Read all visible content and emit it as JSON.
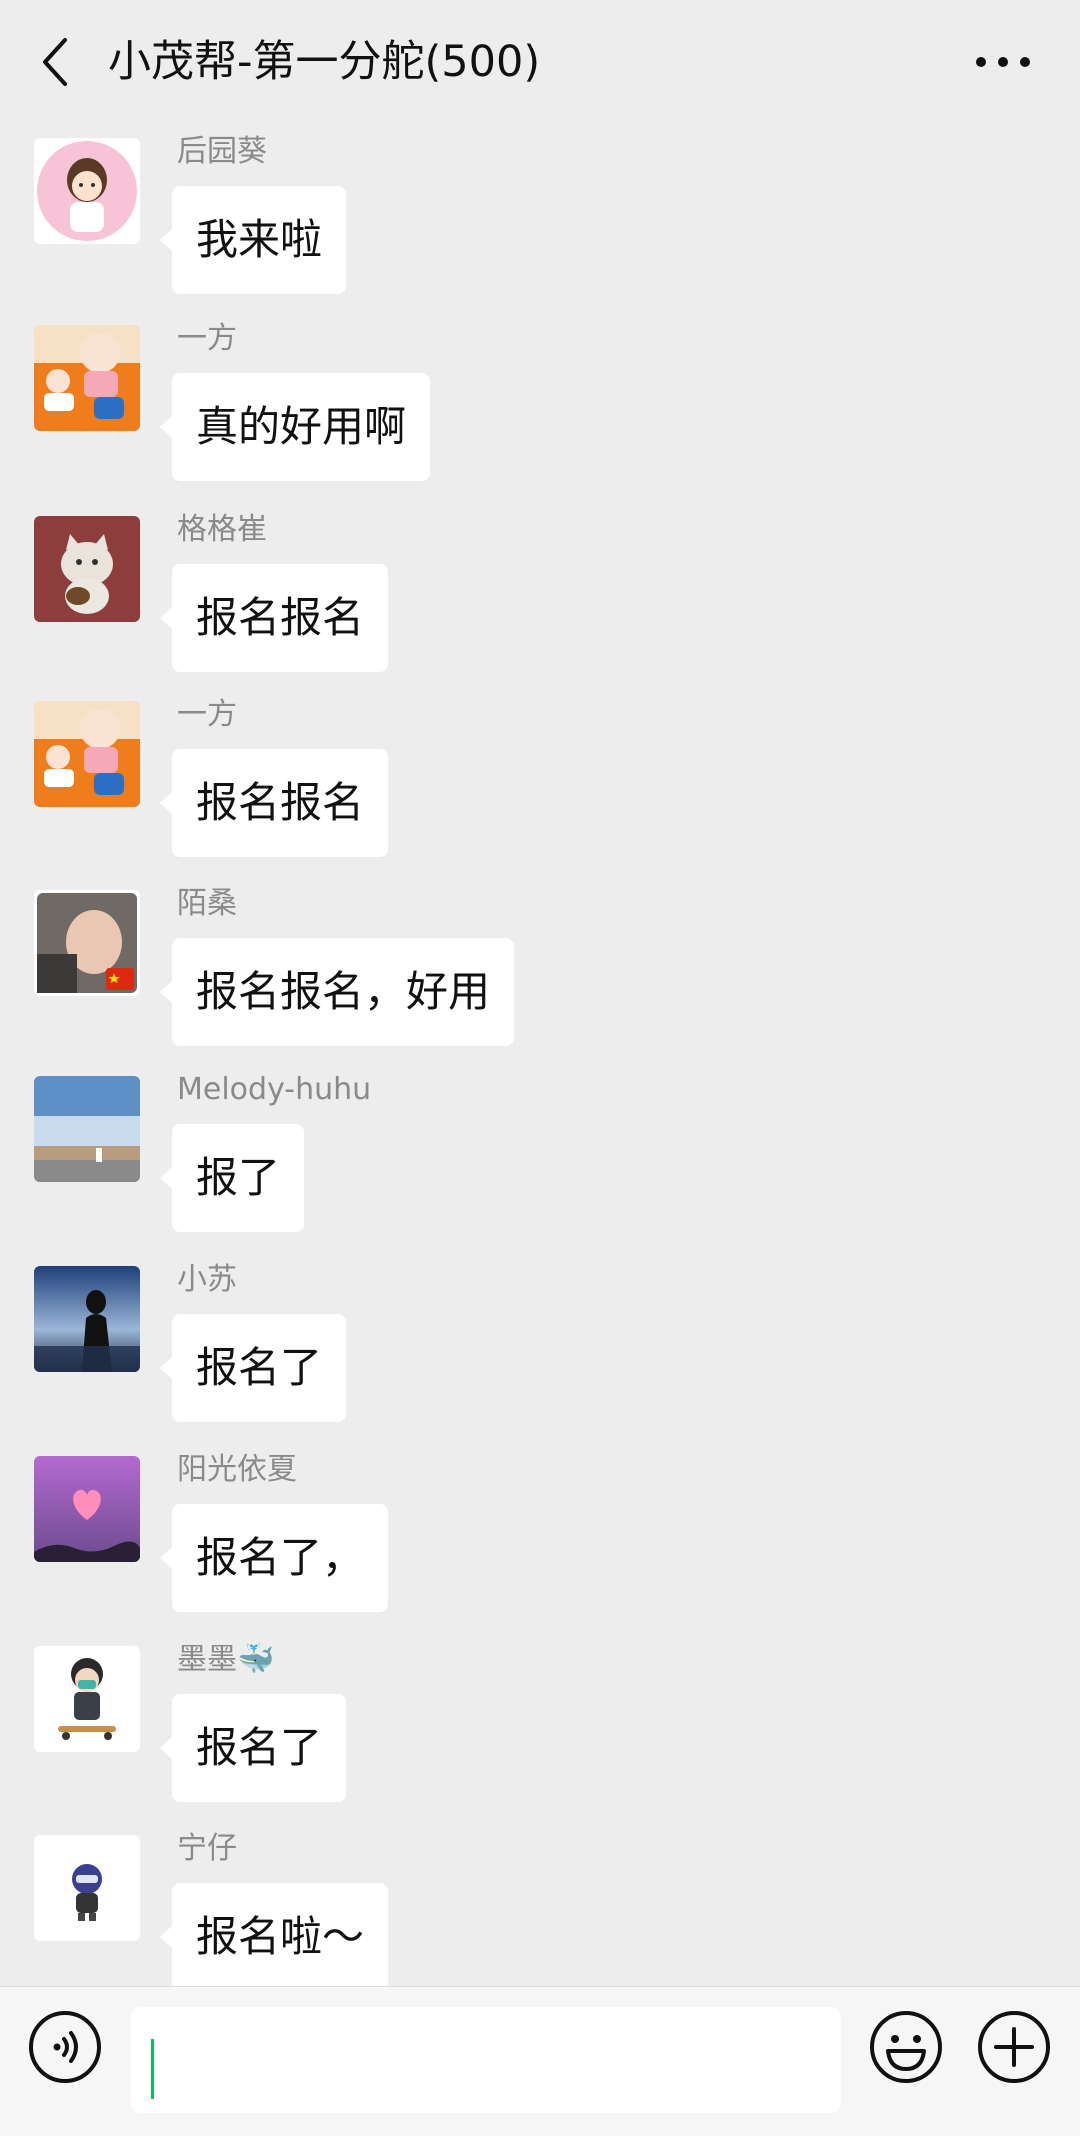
{
  "header": {
    "title": "小茂帮-第一分舵(500)",
    "back_icon": "chevron-left-icon",
    "more_icon": "ellipsis-icon"
  },
  "messages": [
    {
      "sender": "后园葵",
      "text": "我来啦",
      "avatar": "cartoon-girl-avatar"
    },
    {
      "sender": "一方",
      "text": "真的好用啊",
      "avatar": "cartoon-kids-avatar"
    },
    {
      "sender": "格格崔",
      "text": "报名报名",
      "avatar": "cat-guitar-avatar"
    },
    {
      "sender": "一方",
      "text": "报名报名",
      "avatar": "cartoon-kids-avatar"
    },
    {
      "sender": "陌桑",
      "text": "报名报名，好用",
      "avatar": "baby-photo-avatar"
    },
    {
      "sender": "Melody-huhu",
      "text": "报了",
      "avatar": "sky-landscape-avatar"
    },
    {
      "sender": "小苏",
      "text": "报名了",
      "avatar": "sunset-silhouette-avatar"
    },
    {
      "sender": "阳光依夏",
      "text": "报名了，",
      "avatar": "pink-heart-sky-avatar"
    },
    {
      "sender": "墨墨🐳",
      "text": "报名了",
      "avatar": "skateboard-kid-avatar"
    },
    {
      "sender": "宁仔",
      "text": "报名啦～",
      "avatar": "helmet-figure-avatar"
    }
  ],
  "input_bar": {
    "voice_icon": "voice-icon",
    "emoji_icon": "emoji-icon",
    "plus_icon": "plus-icon",
    "text_value": "",
    "caret_color": "#07c160"
  },
  "colors": {
    "background": "#ededed",
    "bubble": "#ffffff",
    "sender_name": "#8a8a8a"
  }
}
